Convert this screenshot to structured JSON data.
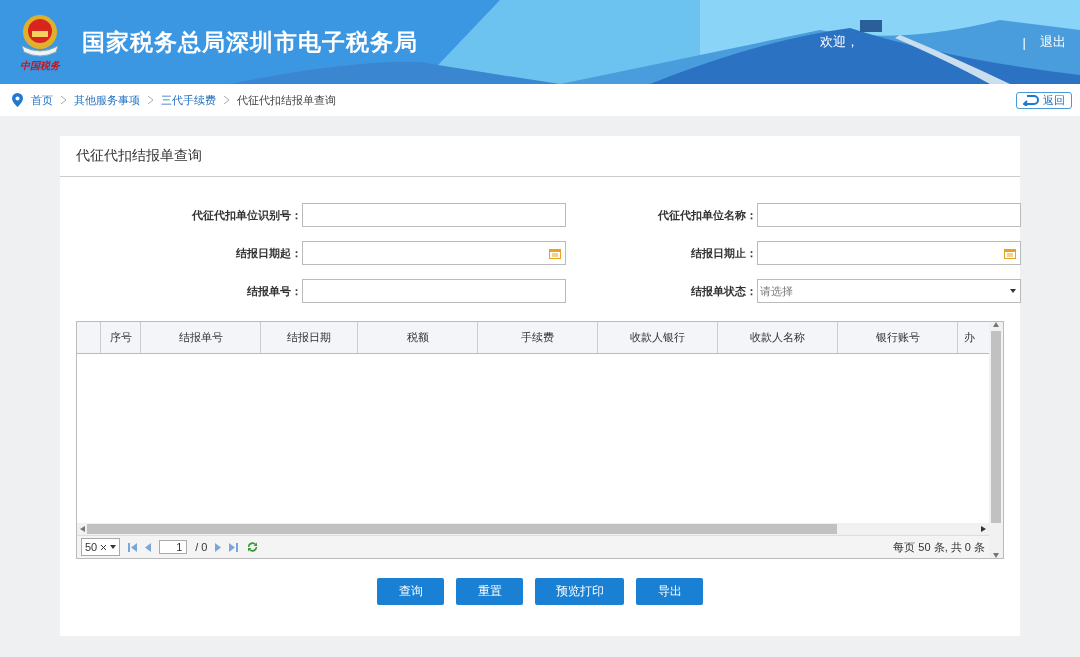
{
  "header": {
    "logo_text": "中国税务",
    "title": "国家税务总局深圳市电子税务局",
    "welcome": "欢迎，",
    "separator": "|",
    "logout": "退出"
  },
  "breadcrumb": {
    "items": [
      "首页",
      "其他服务事项",
      "三代手续费"
    ],
    "current": "代征代扣结报单查询",
    "back": "返回"
  },
  "panel": {
    "title": "代征代扣结报单查询"
  },
  "form": [
    {
      "label": "代征代扣单位识别号：",
      "kind": "text"
    },
    {
      "label": "代征代扣单位名称：",
      "kind": "text"
    },
    {
      "label": "结报日期起：",
      "kind": "date"
    },
    {
      "label": "结报日期止：",
      "kind": "date"
    },
    {
      "label": "结报单号：",
      "kind": "text"
    },
    {
      "label": "结报单状态：",
      "kind": "select",
      "placeholder": "请选择"
    }
  ],
  "table": {
    "columns": [
      "序号",
      "结报单号",
      "结报日期",
      "税额",
      "手续费",
      "收款人银行",
      "收款人名称",
      "银行账号",
      "办"
    ]
  },
  "pager": {
    "page_size": "50",
    "page": "1",
    "total_pages": "/ 0",
    "summary": "每页 50 条, 共 0 条"
  },
  "buttons": [
    "查询",
    "重置",
    "预览打印",
    "导出"
  ]
}
